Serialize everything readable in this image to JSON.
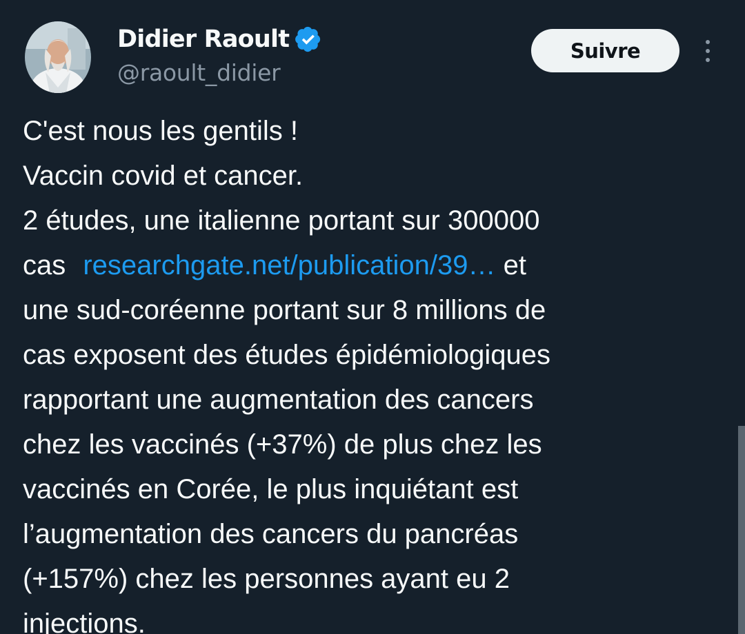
{
  "author": {
    "name": "Didier Raoult",
    "handle": "@raoult_didier",
    "verified": true,
    "verified_icon": "verified-badge-icon",
    "verified_color": "#1d9bf0"
  },
  "actions": {
    "follow_label": "Suivre",
    "more_icon": "more-vertical-icon"
  },
  "tweet": {
    "lines": {
      "l1": "C'est nous les gentils !",
      "l2": "Vaccin covid et cancer.",
      "l3": "2 études, une italienne portant sur 300000",
      "l4_pre": "cas ",
      "l4_link": "researchgate.net/publication/39…",
      "l4_post": " et",
      "l5": "une sud-coréenne portant sur 8 millions de",
      "l6": "cas exposent des études épidémiologiques",
      "l7": "rapportant une augmentation des cancers",
      "l8": "chez les vaccinés (+37%) de plus chez les",
      "l9": "vaccinés en Corée, le plus inquiétant est",
      "l10": "l’augmentation des cancers du pancréas",
      "l11": "(+157%) chez les personnes ayant eu 2",
      "l12": "injections."
    }
  },
  "colors": {
    "background": "#15202b",
    "text": "#f7f9f9",
    "secondary": "#8b98a5",
    "link": "#1d9bf0",
    "button_bg": "#eff3f4",
    "button_text": "#0f1419"
  }
}
